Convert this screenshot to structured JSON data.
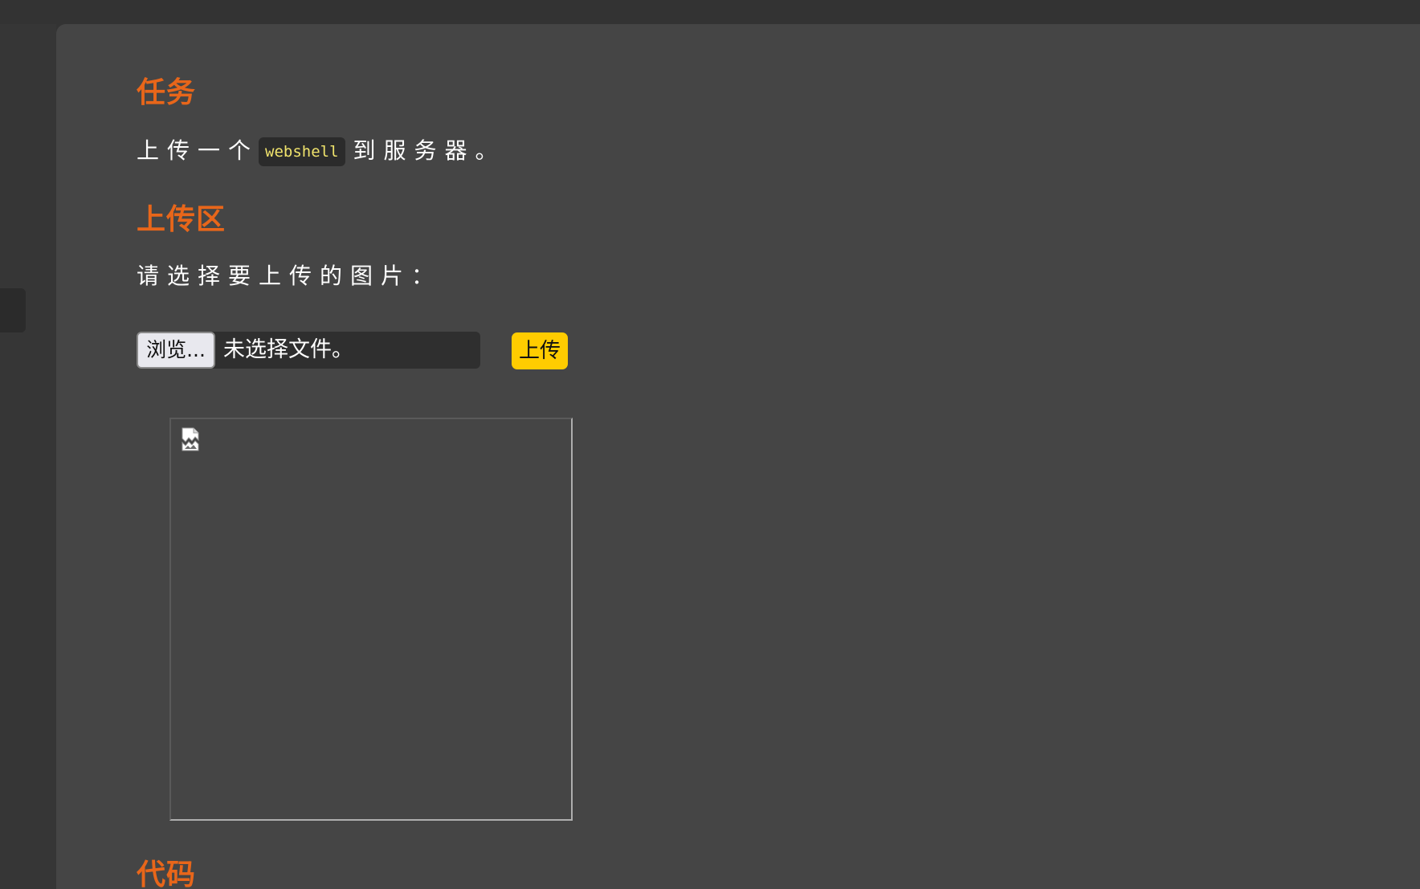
{
  "task": {
    "heading": "任务",
    "text_before": "上传一个",
    "code": "webshell",
    "text_after": "到服务器。"
  },
  "upload": {
    "heading": "上传区",
    "prompt": "请选择要上传的图片：",
    "browse_label": "浏览...",
    "file_status": "未选择文件。",
    "submit_label": "上传"
  },
  "preview": {
    "icon": "broken-image-icon"
  },
  "code_section": {
    "heading": "代码"
  },
  "colors": {
    "heading": "#e8661a",
    "upload_button": "#ffcc00",
    "code_text": "#f0e36c",
    "panel_bg": "#454545"
  }
}
